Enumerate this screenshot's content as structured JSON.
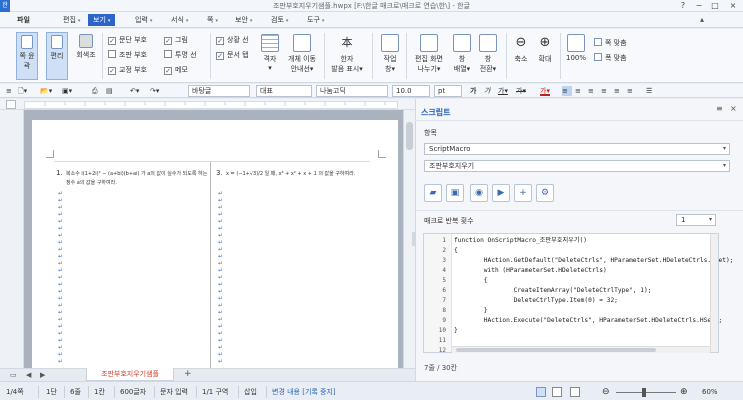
{
  "window": {
    "app_icon": "한",
    "title": "조판부호지우기샘플.hwpx [F:\\한글 매크로\\매크로 연습\\한\\] - 한글",
    "controls": [
      "?",
      "−",
      "□",
      "×"
    ]
  },
  "menu": {
    "file": "파일",
    "items": [
      "편집",
      "보기",
      "입력",
      "서식",
      "쪽",
      "보안",
      "검토",
      "도구"
    ],
    "active": "보기"
  },
  "ribbon": {
    "big_buttons": [
      "쪽 윤곽",
      "편리",
      "회색조"
    ],
    "checkboxes_col1": [
      {
        "label": "문단 부호",
        "checked": true
      },
      {
        "label": "조판 부호",
        "checked": false
      },
      {
        "label": "교정 부호",
        "checked": true
      }
    ],
    "checkboxes_col2": [
      {
        "label": "그림",
        "checked": true
      },
      {
        "label": "투명 선",
        "checked": false
      },
      {
        "label": "메모",
        "checked": true
      }
    ],
    "checkboxes_col3": [
      {
        "label": "상황 선",
        "checked": true
      },
      {
        "label": "문서 탭",
        "checked": true
      }
    ],
    "groups": [
      {
        "label": "격자",
        "sub": "▾"
      },
      {
        "label": "개체 이동",
        "sub": "안내선▾"
      },
      {
        "label": "한자",
        "sub": "발음 표시▾"
      },
      {
        "label": "작업",
        "sub": "창▾"
      },
      {
        "label": "편집 화면",
        "sub": "나누기▾"
      },
      {
        "label": "창",
        "sub": "배열▾"
      },
      {
        "label": "창",
        "sub": "전환▾"
      },
      {
        "label": "축소",
        "sub": ""
      },
      {
        "label": "확대",
        "sub": ""
      },
      {
        "label": "100%",
        "sub": ""
      }
    ],
    "fit_items": [
      "쪽 맞춤",
      "폭 맞춤"
    ]
  },
  "format_toolbar": {
    "style": "바탕글",
    "representative": "대표",
    "font": "나눔고딕",
    "size": "10.0",
    "unit": "pt"
  },
  "document": {
    "q1_num": "1.",
    "q1_text": "복소수 i(1+2i)² − (a+bi)(b+ai) 가 a의 값이 실수가 되도록 하는 정수 a의 값을 구하여라.",
    "q3_num": "3.",
    "q3_text": "x = (−1+√3)/2 일 때, x³ + x² + x + 1 의 값을 구하여라.",
    "para_mark": "↵",
    "paragraph_marks_col1": 25,
    "paragraph_marks_col2": 25
  },
  "doc_tab": {
    "name": "조판부호지우기샘플"
  },
  "status": {
    "page": "1/4쪽",
    "section": "1단",
    "line": "6줄",
    "column": "1칸",
    "chars": "600글자",
    "mode": "문자 입력",
    "division": "1/1 구역",
    "insert": "삽입",
    "track": "변경 내용 [기록 중지]",
    "zoom": "60%"
  },
  "script_panel": {
    "header": "스크립트",
    "section_label": "항목",
    "type_value": "ScriptMacro",
    "macro_value": "조판부호지우기",
    "repeat_label": "매크로 반복 횟수",
    "repeat_value": "1",
    "code_lines": [
      "function OnScriptMacro_조판부호지우기()",
      "{",
      "        HAction.GetDefault(\"DeleteCtrls\", HParameterSet.HDeleteCtrls.HSet);",
      "        with (HParameterSet.HDeleteCtrls)",
      "        {",
      "                CreateItemArray(\"DeleteCtrlType\", 1);",
      "                DeleteCtrlType.Item(0) = 32;",
      "        }",
      "        HAction.Execute(\"DeleteCtrls\", HParameterSet.HDeleteCtrls.HSet);",
      "}",
      "",
      ""
    ],
    "line_numbers": [
      "1",
      "2",
      "3",
      "4",
      "5",
      "6",
      "7",
      "8",
      "9",
      "10",
      "11",
      "12"
    ],
    "position": "7줄 / 30칸"
  }
}
